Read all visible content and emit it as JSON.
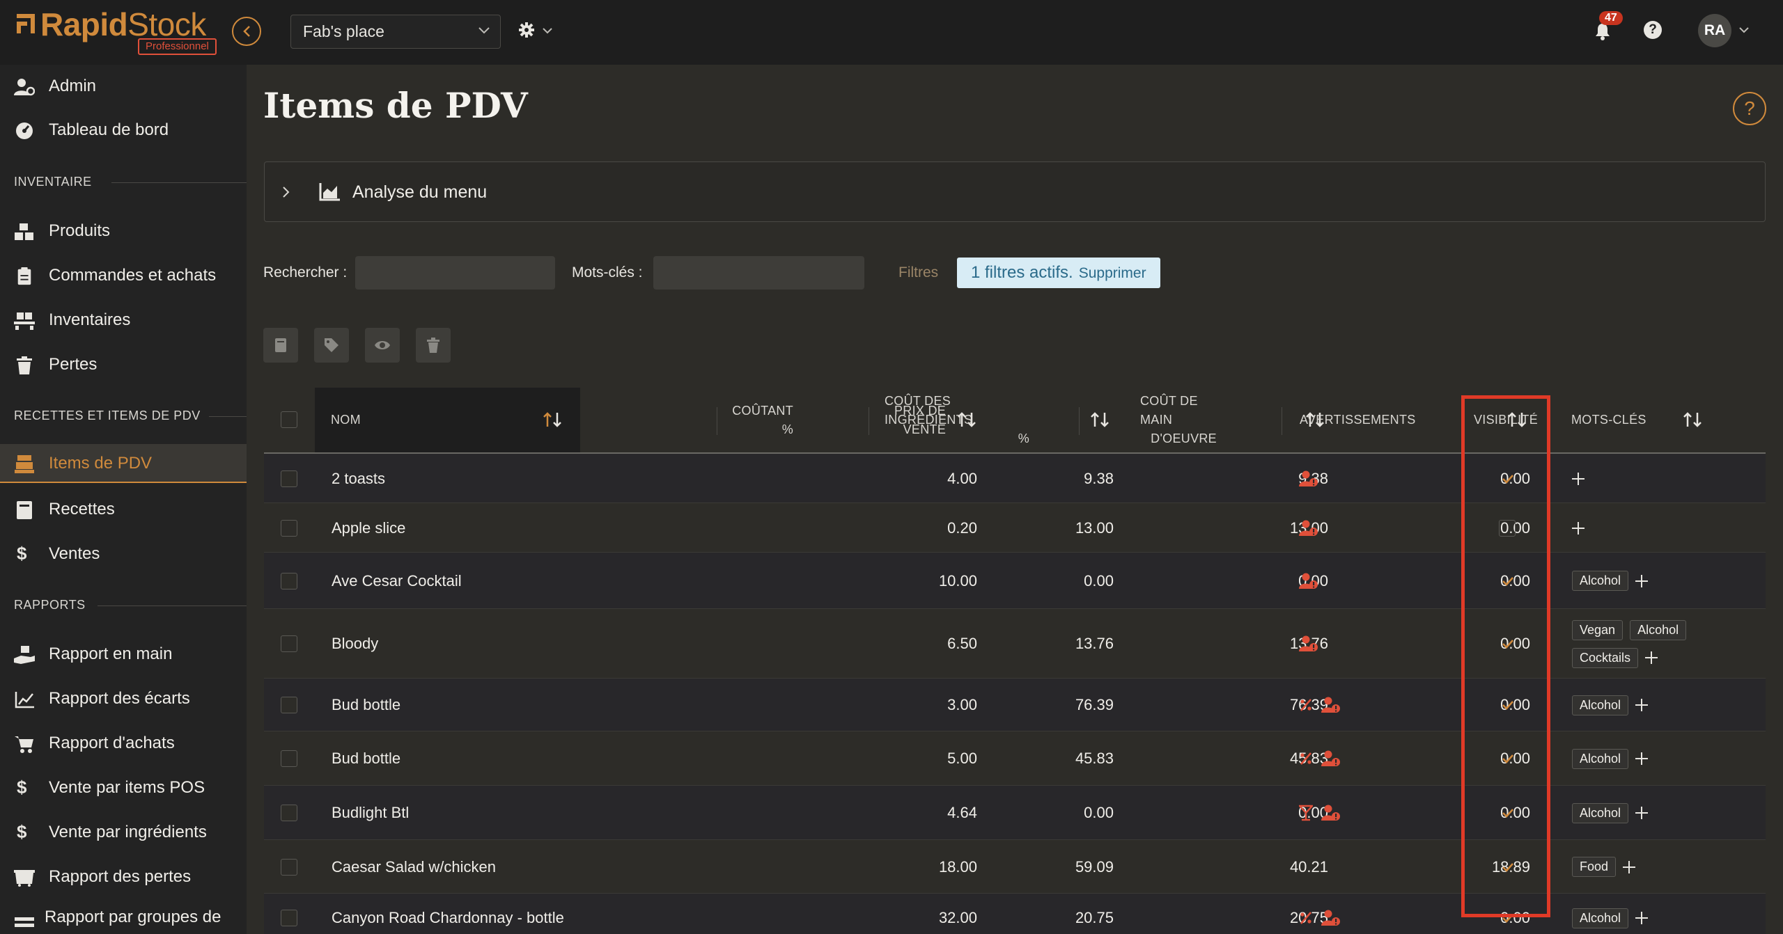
{
  "brand": {
    "name_bold": "Rapid",
    "name_thin": "Stock",
    "plan_badge": "Professionnel",
    "accent": "#d08a3c"
  },
  "topbar": {
    "venue": "Fab's place",
    "notifications_count": "47",
    "help_glyph": "?",
    "user_initials": "RA"
  },
  "sidebar": {
    "top_items": [
      {
        "label": "Admin",
        "icon": "user-cog-icon"
      },
      {
        "label": "Tableau de bord",
        "icon": "dashboard-icon"
      }
    ],
    "sections": [
      {
        "title": "INVENTAIRE",
        "items": [
          {
            "label": "Produits",
            "icon": "boxes-icon"
          },
          {
            "label": "Commandes et achats",
            "icon": "clipboard-icon"
          },
          {
            "label": "Inventaires",
            "icon": "pallet-icon"
          },
          {
            "label": "Pertes",
            "icon": "trash-icon"
          }
        ]
      },
      {
        "title": "RECETTES ET ITEMS DE PDV",
        "items": [
          {
            "label": "Items de PDV",
            "icon": "register-icon",
            "active": true
          },
          {
            "label": "Recettes",
            "icon": "book-icon"
          },
          {
            "label": "Ventes",
            "icon": "dollar-icon"
          }
        ]
      },
      {
        "title": "RAPPORTS",
        "items": [
          {
            "label": "Rapport en main",
            "icon": "hand-box-icon"
          },
          {
            "label": "Rapport des écarts",
            "icon": "line-chart-icon"
          },
          {
            "label": "Rapport d'achats",
            "icon": "cart-icon"
          },
          {
            "label": "Vente par items POS",
            "icon": "dollar-icon"
          },
          {
            "label": "Vente par ingrédients",
            "icon": "dollar-icon"
          },
          {
            "label": "Rapport des pertes",
            "icon": "dumpster-icon"
          },
          {
            "label": "Rapport par groupes de",
            "icon": "layers-icon"
          }
        ]
      }
    ]
  },
  "main": {
    "title": "Items de PDV",
    "help_glyph": "?",
    "menu_analysis": "Analyse du menu",
    "search_label": "Rechercher :",
    "keywords_label": "Mots-clés :",
    "filters_label": "Filtres",
    "filters_active": "1 filtres actifs.",
    "filters_clear": "Supprimer"
  },
  "table": {
    "columns": {
      "name": "NOM",
      "price": [
        "PRIX DE",
        "VENTE"
      ],
      "cost": [
        "COÛTANT",
        "%"
      ],
      "ingredients": [
        "COÛT DES INGRÉDIENTS",
        "%"
      ],
      "labor": [
        "COÛT DE MAIN",
        "D'OEUVRE"
      ],
      "warnings": "AVERTISSEMENTS",
      "visibility": "VISIBILITÉ",
      "keywords": "MOTS-CLÉS"
    },
    "rows": [
      {
        "name": "2 toasts",
        "price": "4.00",
        "cost": "9.38",
        "ingredients": "9.38",
        "labor": "0.00",
        "warnings": [
          "user-alert-icon"
        ],
        "visible": true,
        "keywords": []
      },
      {
        "name": "Apple slice",
        "price": "0.20",
        "cost": "13.00",
        "ingredients": "13.00",
        "labor": "0.00",
        "warnings": [
          "user-alert-icon"
        ],
        "visible": false,
        "keywords": []
      },
      {
        "name": "Ave Cesar Cocktail",
        "price": "10.00",
        "cost": "0.00",
        "ingredients": "0.00",
        "labor": "0.00",
        "warnings": [
          "user-alert-icon"
        ],
        "visible": true,
        "keywords": [
          "Alcohol"
        ]
      },
      {
        "name": "Bloody",
        "price": "6.50",
        "cost": "13.76",
        "ingredients": "13.76",
        "labor": "0.00",
        "warnings": [
          "user-alert-icon"
        ],
        "visible": true,
        "keywords": [
          "Vegan",
          "Alcohol",
          "Cocktails"
        ]
      },
      {
        "name": "Bud bottle",
        "price": "3.00",
        "cost": "76.39",
        "ingredients": "76.39",
        "labor": "0.00",
        "warnings": [
          "percent-icon",
          "user-alert-icon"
        ],
        "visible": true,
        "keywords": [
          "Alcohol"
        ]
      },
      {
        "name": "Bud bottle",
        "price": "5.00",
        "cost": "45.83",
        "ingredients": "45.83",
        "labor": "0.00",
        "warnings": [
          "percent-icon",
          "user-alert-icon"
        ],
        "visible": true,
        "keywords": [
          "Alcohol"
        ]
      },
      {
        "name": "Budlight Btl",
        "price": "4.64",
        "cost": "0.00",
        "ingredients": "0.00",
        "labor": "0.00",
        "warnings": [
          "cocktail-icon",
          "user-alert-icon"
        ],
        "visible": true,
        "keywords": [
          "Alcohol"
        ]
      },
      {
        "name": "Caesar Salad w/chicken",
        "price": "18.00",
        "cost": "59.09",
        "ingredients": "40.21",
        "labor": "18.89",
        "warnings": [],
        "visible": true,
        "keywords": [
          "Food"
        ]
      },
      {
        "name": "Canyon Road Chardonnay - bottle",
        "price": "32.00",
        "cost": "20.75",
        "ingredients": "20.75",
        "labor": "0.00",
        "warnings": [
          "percent-icon",
          "user-alert-icon"
        ],
        "visible": true,
        "keywords": [
          "Alcohol"
        ]
      }
    ]
  },
  "colors": {
    "warning": "#e0503a",
    "check": "#d08a3c",
    "highlight": "#e03a27"
  }
}
